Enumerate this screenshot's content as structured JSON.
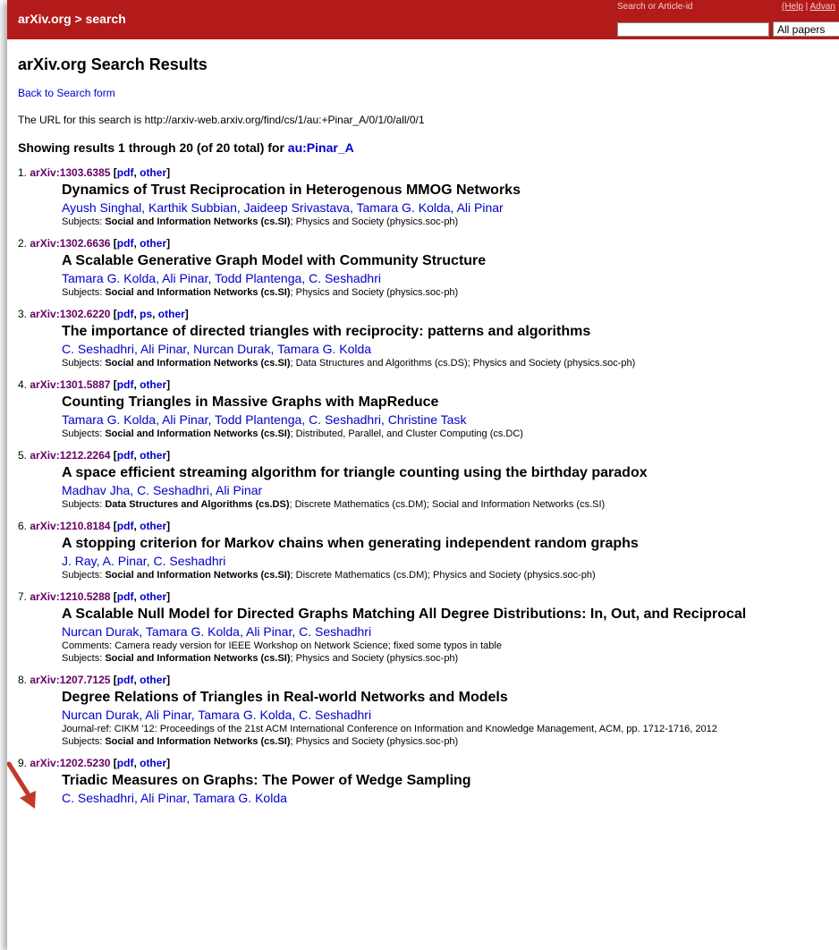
{
  "header": {
    "breadcrumb": "arXiv.org > search",
    "search_label": "Search or Article-id",
    "help_links": [
      "(Help",
      "Advan"
    ],
    "search_value": "",
    "select_value": "All papers"
  },
  "page": {
    "title": "arXiv.org Search Results",
    "back_link": "Back to Search form",
    "url_text": "The URL for this search is http://arxiv-web.arxiv.org/find/cs/1/au:+Pinar_A/0/1/0/all/0/1",
    "showing_text": "Showing results 1 through 20 (of 20 total) for",
    "query": "au:Pinar_A"
  },
  "results": [
    {
      "num": "1.",
      "id": "arXiv:1303.6385",
      "formats": [
        "pdf",
        "other"
      ],
      "title": "Dynamics of Trust Reciprocation in Heterogenous MMOG Networks",
      "authors": [
        "Ayush Singhal",
        "Karthik Subbian",
        "Jaideep Srivastava",
        "Tamara G. Kolda",
        "Ali Pinar"
      ],
      "extra": [],
      "subjects_bold": "Social and Information Networks (cs.SI)",
      "subjects_rest": "; Physics and Society (physics.soc-ph)"
    },
    {
      "num": "2.",
      "id": "arXiv:1302.6636",
      "formats": [
        "pdf",
        "other"
      ],
      "title": "A Scalable Generative Graph Model with Community Structure",
      "authors": [
        "Tamara G. Kolda",
        "Ali Pinar",
        "Todd Plantenga",
        "C. Seshadhri"
      ],
      "extra": [],
      "subjects_bold": "Social and Information Networks (cs.SI)",
      "subjects_rest": "; Physics and Society (physics.soc-ph)"
    },
    {
      "num": "3.",
      "id": "arXiv:1302.6220",
      "formats": [
        "pdf",
        "ps",
        "other"
      ],
      "title": "The importance of directed triangles with reciprocity: patterns and algorithms",
      "authors": [
        "C. Seshadhri",
        "Ali Pinar",
        "Nurcan Durak",
        "Tamara G. Kolda"
      ],
      "extra": [],
      "subjects_bold": "Social and Information Networks (cs.SI)",
      "subjects_rest": "; Data Structures and Algorithms (cs.DS); Physics and Society (physics.soc-ph)"
    },
    {
      "num": "4.",
      "id": "arXiv:1301.5887",
      "formats": [
        "pdf",
        "other"
      ],
      "title": "Counting Triangles in Massive Graphs with MapReduce",
      "authors": [
        "Tamara G. Kolda",
        "Ali Pinar",
        "Todd Plantenga",
        "C. Seshadhri",
        "Christine Task"
      ],
      "extra": [],
      "subjects_bold": "Social and Information Networks (cs.SI)",
      "subjects_rest": "; Distributed, Parallel, and Cluster Computing (cs.DC)"
    },
    {
      "num": "5.",
      "id": "arXiv:1212.2264",
      "formats": [
        "pdf",
        "other"
      ],
      "title": "A space efficient streaming algorithm for triangle counting using the birthday paradox",
      "authors": [
        "Madhav Jha",
        "C. Seshadhri",
        "Ali Pinar"
      ],
      "extra": [],
      "subjects_bold": "Data Structures and Algorithms (cs.DS)",
      "subjects_rest": "; Discrete Mathematics (cs.DM); Social and Information Networks (cs.SI)"
    },
    {
      "num": "6.",
      "id": "arXiv:1210.8184",
      "formats": [
        "pdf",
        "other"
      ],
      "title": "A stopping criterion for Markov chains when generating independent random graphs",
      "authors": [
        "J. Ray",
        "A. Pinar",
        "C. Seshadhri"
      ],
      "extra": [],
      "subjects_bold": "Social and Information Networks (cs.SI)",
      "subjects_rest": "; Discrete Mathematics (cs.DM); Physics and Society (physics.soc-ph)"
    },
    {
      "num": "7.",
      "id": "arXiv:1210.5288",
      "formats": [
        "pdf",
        "other"
      ],
      "title": "A Scalable Null Model for Directed Graphs Matching All Degree Distributions: In, Out, and Reciprocal",
      "authors": [
        "Nurcan Durak",
        "Tamara G. Kolda",
        "Ali Pinar",
        "C. Seshadhri"
      ],
      "extra": [
        "Comments: Camera ready version for IEEE Workshop on Network Science; fixed some typos in table"
      ],
      "subjects_bold": "Social and Information Networks (cs.SI)",
      "subjects_rest": "; Physics and Society (physics.soc-ph)"
    },
    {
      "num": "8.",
      "id": "arXiv:1207.7125",
      "formats": [
        "pdf",
        "other"
      ],
      "title": "Degree Relations of Triangles in Real-world Networks and Models",
      "authors": [
        "Nurcan Durak",
        "Ali Pinar",
        "Tamara G. Kolda",
        "C. Seshadhri"
      ],
      "extra": [
        "Journal-ref: CIKM '12: Proceedings of the 21st ACM International Conference on Information and Knowledge Management, ACM, pp. 1712-1716, 2012"
      ],
      "subjects_bold": "Social and Information Networks (cs.SI)",
      "subjects_rest": "; Physics and Society (physics.soc-ph)"
    },
    {
      "num": "9.",
      "id": "arXiv:1202.5230",
      "formats": [
        "pdf",
        "other"
      ],
      "title": "Triadic Measures on Graphs: The Power of Wedge Sampling",
      "authors": [
        "C. Seshadhri",
        "Ali Pinar",
        "Tamara G. Kolda"
      ],
      "extra": [],
      "subjects_bold": "",
      "subjects_rest": ""
    }
  ],
  "labels": {
    "subjects_prefix": "Subjects: "
  },
  "colors": {
    "header_bg": "#b31b1b",
    "link": "#0000cc",
    "arxiv_id": "#660066",
    "arrow": "#c0392b"
  }
}
